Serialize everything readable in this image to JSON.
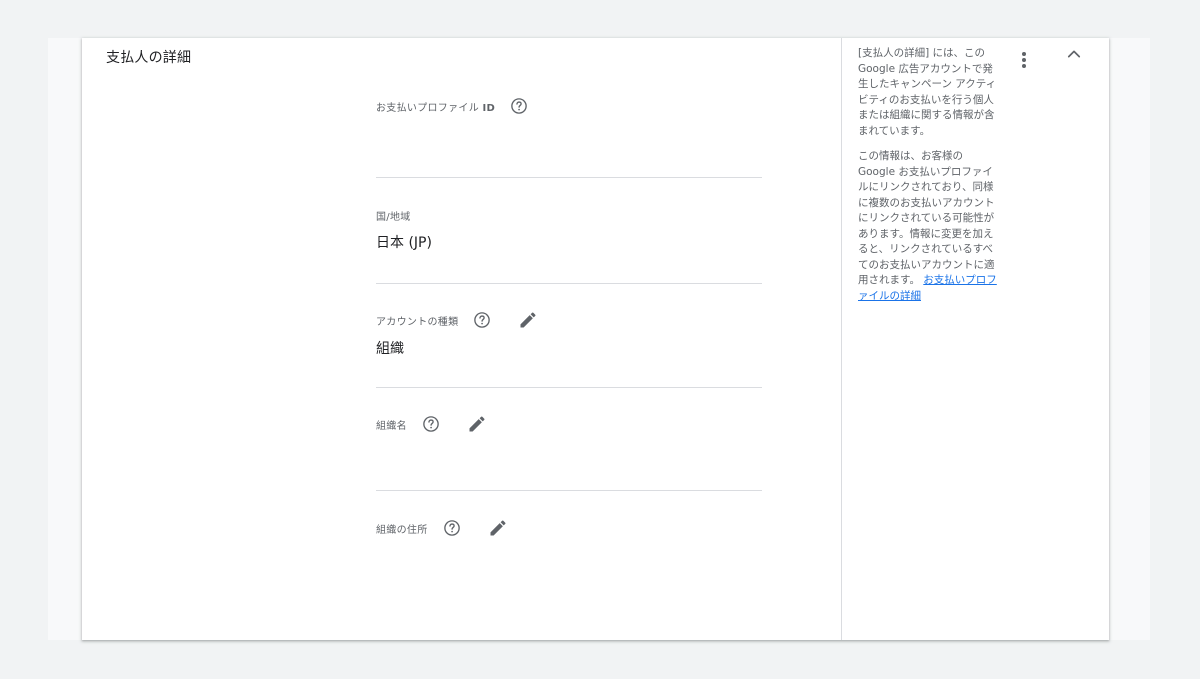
{
  "section": {
    "title": "支払人の詳細"
  },
  "fields": {
    "profile_id": {
      "label_prefix": "お支払いプロファイル ",
      "label_bold": "ID",
      "value": ""
    },
    "country": {
      "label": "国/地域",
      "value": "日本 (JP)"
    },
    "account_type": {
      "label": "アカウントの種類",
      "value": "組織"
    },
    "org_name": {
      "label": "組織名",
      "value": ""
    },
    "org_address": {
      "label": "組織の住所",
      "value": ""
    }
  },
  "help": {
    "paragraph1": "[支払人の詳細] には、この Google 広告アカウントで発生したキャンペーン アクティビティのお支払いを行う個人または組織に関する情報が含まれています。",
    "paragraph2": "この情報は、お客様の Google お支払いプロファイルにリンクされており、同様に複数のお支払いアカウントにリンクされている可能性があります。情報に変更を加えると、リンクされているすべてのお支払いアカウントに適用されます。",
    "link": "お支払いプロファイルの詳細"
  },
  "icons": {
    "help": "help-circle-icon",
    "edit": "pencil-icon",
    "more": "more-vert-icon",
    "collapse": "chevron-up-icon"
  },
  "colors": {
    "link": "#1a73e8",
    "icon": "#5f6368",
    "divider": "#dadce0"
  }
}
